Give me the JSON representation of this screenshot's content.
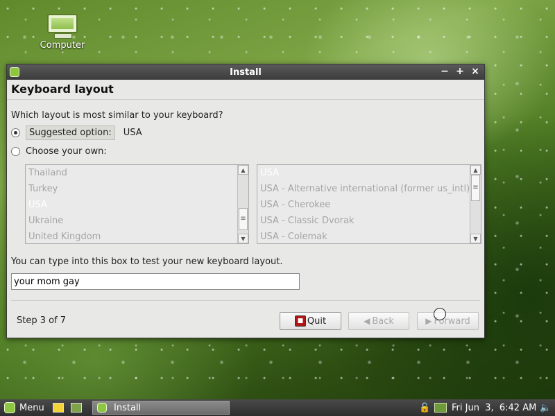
{
  "desktop": {
    "icons": [
      {
        "label": "Computer",
        "icon": "computer-icon"
      }
    ]
  },
  "window": {
    "title": "Install",
    "controls": {
      "minimize": "−",
      "maximize": "+",
      "close": "×"
    },
    "heading": "Keyboard layout",
    "question": "Which layout is most similar to your keyboard?",
    "suggested": {
      "label": "Suggested option:",
      "value": "USA",
      "checked": true
    },
    "choose_own": {
      "label": "Choose your own:",
      "checked": false
    },
    "layout_list": {
      "items": [
        "Thailand",
        "Turkey",
        "USA",
        "Ukraine",
        "United Kingdom"
      ],
      "selected": "USA"
    },
    "variant_list": {
      "items": [
        "USA",
        "USA - Alternative international (former us_intl)",
        "USA - Cherokee",
        "USA - Classic Dvorak",
        "USA - Colemak"
      ],
      "selected": "USA"
    },
    "test_label": "You can type into this box to test your new keyboard layout.",
    "test_input": "your mom gay",
    "step": "Step 3 of 7",
    "buttons": {
      "quit": "Quit",
      "back": "Back",
      "forward": "Forward"
    }
  },
  "taskbar": {
    "menu_label": "Menu",
    "task_label": "Install",
    "clock": "Fri Jun  3,  6:42 AM"
  },
  "colors": {
    "desktop_green": "#5f8a2c",
    "titlebar": "#3c3c3c",
    "mint_accent": "#8dc63f",
    "quit_red": "#b01818"
  }
}
